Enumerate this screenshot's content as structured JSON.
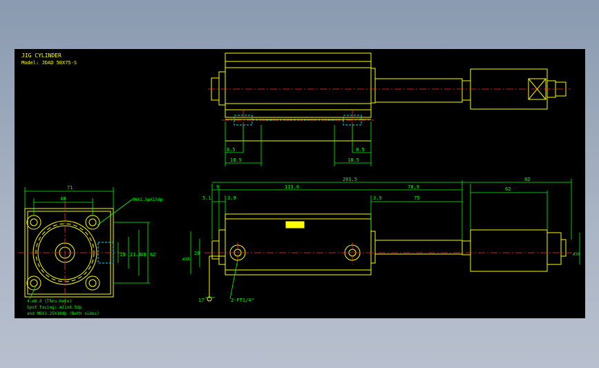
{
  "title_block": {
    "name": "JIG CYLINDER",
    "model": "Model: JDAD 50X75-S"
  },
  "colors": {
    "outline": "#ffff00",
    "dimension": "#00ff00",
    "centerline": "#ff3030",
    "hidden": "#00e5ff",
    "background": "#000000"
  },
  "top_view": {
    "dims": [
      "8.5",
      "18.5",
      "8.5",
      "18.5"
    ]
  },
  "end_view": {
    "dims": [
      "71",
      "48",
      "M6X1.5pX15dp",
      "19",
      "21.6",
      "48",
      "62"
    ],
    "notes": [
      "4-ø6.8 (Thru-hole)",
      "Spot facing: ø11x6.5dp",
      "and M8X1.25X10dp (Both sides)"
    ]
  },
  "side_view": {
    "dims": [
      "201.5",
      "82",
      "9",
      "113.6",
      "78.9",
      "62",
      "5.1",
      "3.9",
      "3.9",
      "75",
      "20",
      "ø38",
      "ø36",
      "17"
    ],
    "port_label": "2-PT1/4\""
  }
}
